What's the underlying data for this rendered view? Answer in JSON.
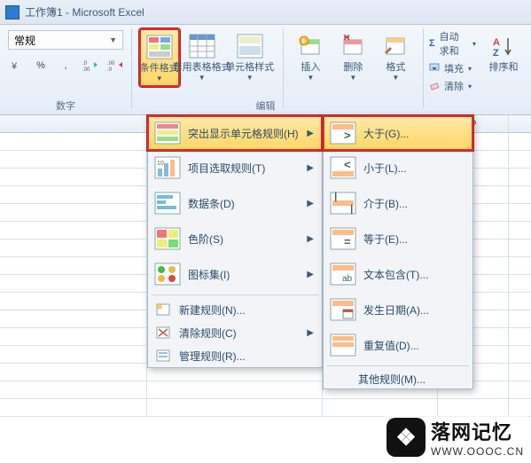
{
  "window": {
    "title": "工作簿1 - Microsoft Excel"
  },
  "ribbon": {
    "number_format": "常规",
    "btn_percent": "%",
    "btn_comma": ",",
    "btn_inc_dec": ".0",
    "btn_dec_dec": ".00",
    "group_number": "数字",
    "cond_format": "条件格式",
    "table_format": "套用表格格式",
    "cell_styles": "单元格样式",
    "insert": "插入",
    "delete": "删除",
    "format": "格式",
    "autosum": "自动求和",
    "fill": "填充",
    "clear": "清除",
    "sort": "排序和",
    "group_edit": "编辑"
  },
  "menu1": {
    "highlight_rules": "突出显示单元格规则(H)",
    "top_bottom": "项目选取规则(T)",
    "data_bars": "数据条(D)",
    "color_scales": "色阶(S)",
    "icon_sets": "图标集(I)",
    "new_rule": "新建规则(N)...",
    "clear_rules": "清除规则(C)",
    "manage_rules": "管理规则(R)..."
  },
  "menu2": {
    "greater": "大于(G)...",
    "less": "小于(L)...",
    "between": "介于(B)...",
    "equal": "等于(E)...",
    "text_contains": "文本包含(T)...",
    "date_occurring": "发生日期(A)...",
    "duplicate": "重复值(D)...",
    "more": "其他规则(M)..."
  },
  "columns": [
    "",
    "",
    "",
    "",
    "",
    "",
    "",
    "P"
  ],
  "watermark": {
    "main": "落网记忆",
    "sub": "WWW.OOOC.CN"
  }
}
